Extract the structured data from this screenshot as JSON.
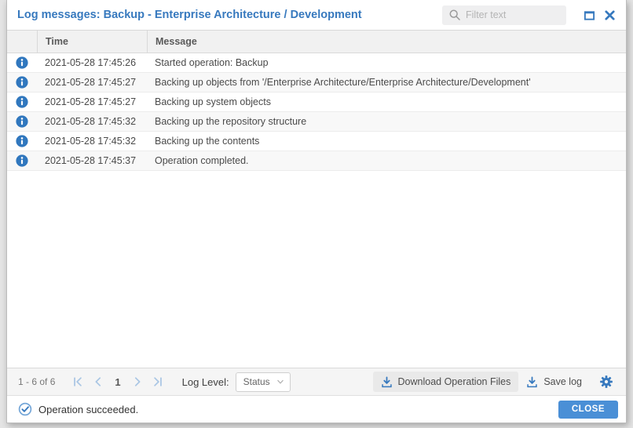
{
  "colors": {
    "accent_blue": "#3779be",
    "close_button_blue": "#4a8fd6",
    "pagination_arrow": "#a9c6e4",
    "header_bg": "#f1f1f1",
    "footer_bg": "#f5f5f5"
  },
  "titlebar": {
    "title": "Log messages: Backup - Enterprise Architecture / Development",
    "filter_placeholder": "Filter text"
  },
  "table": {
    "columns": {
      "time": "Time",
      "message": "Message"
    },
    "rows": [
      {
        "time": "2021-05-28 17:45:26",
        "message": "Started operation: Backup"
      },
      {
        "time": "2021-05-28 17:45:27",
        "message": "Backing up objects from '/Enterprise Architecture/Enterprise Architecture/Development'"
      },
      {
        "time": "2021-05-28 17:45:27",
        "message": "Backing up system objects"
      },
      {
        "time": "2021-05-28 17:45:32",
        "message": "Backing up the repository structure"
      },
      {
        "time": "2021-05-28 17:45:32",
        "message": "Backing up the contents"
      },
      {
        "time": "2021-05-28 17:45:37",
        "message": "Operation completed."
      }
    ]
  },
  "footer": {
    "range_text": "1 - 6 of 6",
    "page_number": "1",
    "log_level_label": "Log Level:",
    "log_level_value": "Status",
    "download_button": "Download Operation Files",
    "save_button": "Save log"
  },
  "statusbar": {
    "status_text": "Operation succeeded.",
    "close_button": "CLOSE"
  }
}
